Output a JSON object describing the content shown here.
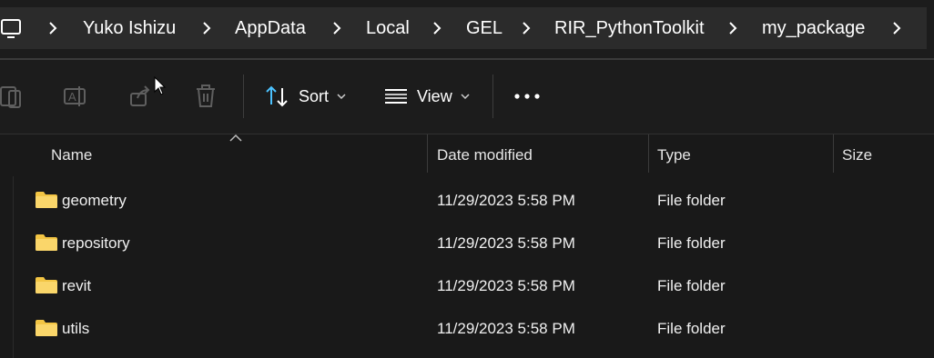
{
  "breadcrumb": {
    "items": [
      "Yuko Ishizu",
      "AppData",
      "Local",
      "GEL",
      "RIR_PythonToolkit",
      "my_package"
    ]
  },
  "toolbar": {
    "sort_label": "Sort",
    "view_label": "View"
  },
  "columns": {
    "name": "Name",
    "date": "Date modified",
    "type": "Type",
    "size": "Size"
  },
  "files": [
    {
      "name": "geometry",
      "date": "11/29/2023 5:58 PM",
      "type": "File folder"
    },
    {
      "name": "repository",
      "date": "11/29/2023 5:58 PM",
      "type": "File folder"
    },
    {
      "name": "revit",
      "date": "11/29/2023 5:58 PM",
      "type": "File folder"
    },
    {
      "name": "utils",
      "date": "11/29/2023 5:58 PM",
      "type": "File folder"
    }
  ],
  "colors": {
    "accent_blue": "#4cc2ff",
    "folder_yellow": "#f3c544",
    "background": "#191919"
  }
}
